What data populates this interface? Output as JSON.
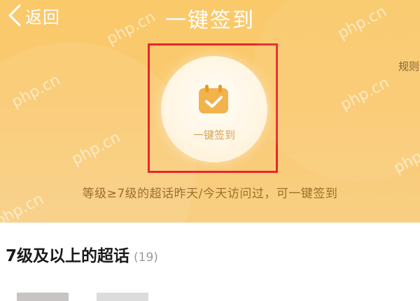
{
  "header": {
    "back_label": "返回",
    "title": "一键签到"
  },
  "rules_link": "规则说",
  "signin": {
    "button_label": "一键签到",
    "icon": "calendar-check-icon"
  },
  "hint_text": "等级≥7级的超话昨天/今天访问过，可一键签到",
  "section": {
    "title": "7级及以上的超话",
    "count": "(19)"
  },
  "watermark": "php.cn",
  "colors": {
    "hero_top": "#f9c96a",
    "hero_bottom": "#f8cf83",
    "highlight_frame": "#e8262c",
    "icon_orange": "#f2b24c"
  }
}
